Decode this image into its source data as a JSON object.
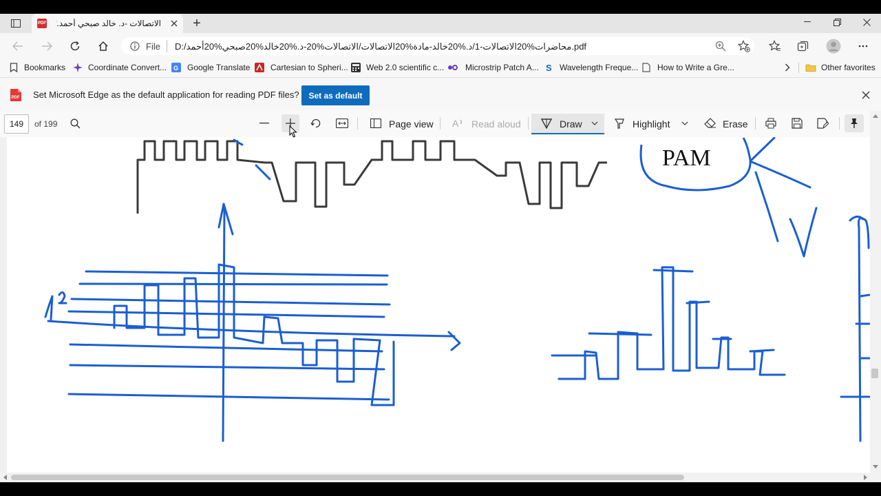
{
  "browser": {
    "tab_title": "الاتصالات -د. خالد صبحي أحمد.pdf*",
    "new_tab_symbol": "+",
    "address_prefix": "File",
    "address_url": "D:/محاضرات%20الاتصالات-1/د.%20خالد-مادة%20الاتصالات/الاتصالات%20-د.%20خالد%20صبحي%20أحمد.pdf",
    "window_controls": [
      "minimize",
      "restore",
      "close"
    ]
  },
  "bookmarks": {
    "items": [
      {
        "label": "Bookmarks",
        "icon": "bookmark-icon",
        "color": "#444444"
      },
      {
        "label": "Coordinate Convert...",
        "icon": "spark-icon",
        "color": "#6a3db8"
      },
      {
        "label": "Google Translate",
        "icon": "translate-icon",
        "color": "#4285f4"
      },
      {
        "label": "Cartesian to Spheri...",
        "icon": "site-icon",
        "color": "#c62828"
      },
      {
        "label": "Web 2.0 scientific c...",
        "icon": "calculator-icon",
        "color": "#333333"
      },
      {
        "label": "Microstrip Patch A...",
        "icon": "site-icon",
        "color": "#6a3db8"
      },
      {
        "label": "Wavelength Freque...",
        "icon": "site-icon",
        "color": "#1565c0"
      },
      {
        "label": "How to Write a Gre...",
        "icon": "page-icon",
        "color": "#555555"
      }
    ],
    "other_favorites": "Other favorites"
  },
  "infobar": {
    "message": "Set Microsoft Edge as the default application for reading PDF files?",
    "button_label": "Set as default"
  },
  "pdf_toolbar": {
    "page_number": "149",
    "page_total": "of 199",
    "page_view": "Page view",
    "read_aloud": "Read aloud",
    "draw": "Draw",
    "highlight": "Highlight",
    "erase": "Erase"
  },
  "document": {
    "pam_label": "PAM"
  },
  "colors": {
    "accent": "#0f6cbd",
    "ink": "#1a5fd1"
  }
}
